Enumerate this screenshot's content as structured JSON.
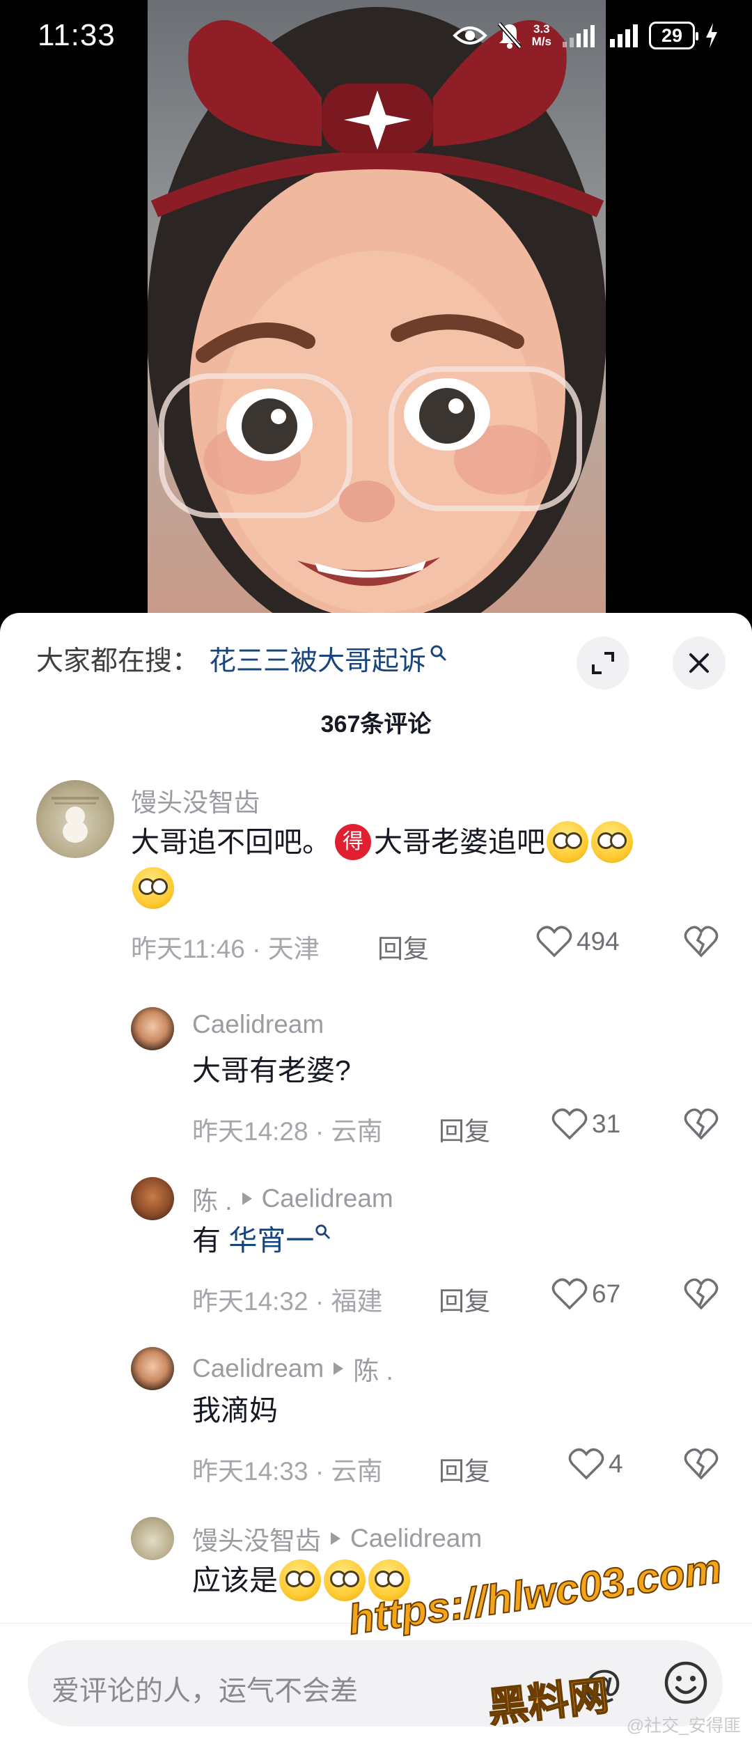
{
  "status_bar": {
    "time": "11:33",
    "speed_value": "3.3",
    "speed_unit": "M/s",
    "battery": "29"
  },
  "search_suggest": {
    "prefix": "大家都在搜：",
    "query": "花三三被大哥起诉"
  },
  "comment_count": "367条评论",
  "comments": [
    {
      "user": "馒头没智齿",
      "text_part1": "大哥追不回吧。",
      "badge": "得",
      "text_part2": "大哥老婆追吧",
      "time_location": "昨天11:46 · 天津",
      "reply_label": "回复",
      "likes": "494"
    },
    {
      "user": "Caelidream",
      "text": "大哥有老婆?",
      "time_location": "昨天14:28 · 云南",
      "reply_label": "回复",
      "likes": "31"
    },
    {
      "user": "陈 .",
      "reply_to": "Caelidream",
      "text_prefix": "有",
      "text_link": "华宵一",
      "time_location": "昨天14:32 · 福建",
      "reply_label": "回复",
      "likes": "67"
    },
    {
      "user": "Caelidream",
      "reply_to": "陈 .",
      "text": "我滴妈",
      "time_location": "昨天14:33 · 云南",
      "reply_label": "回复",
      "likes": "4"
    },
    {
      "user": "馒头没智齿",
      "reply_to": "Caelidream",
      "text": "应该是"
    }
  ],
  "input_bar": {
    "placeholder": "爱评论的人，运气不会差",
    "mention": "@"
  },
  "watermarks": {
    "url": "https://hlwc03.com",
    "site": "黑料网",
    "credit": "@社交_安得匪"
  },
  "colors": {
    "link": "#19457d",
    "badge_red": "#e02031",
    "watermark_orange": "#f3a51a"
  },
  "icons": [
    "search-icon",
    "expand-icon",
    "close-icon",
    "heart-icon",
    "broken-heart-icon",
    "emoji-icon",
    "eye-icon",
    "mute-icon",
    "signal-icon",
    "charging-icon"
  ]
}
